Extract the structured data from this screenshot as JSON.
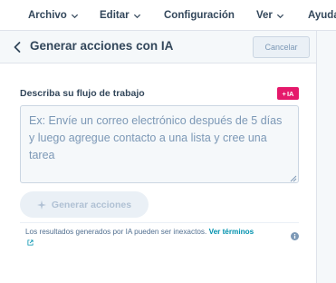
{
  "menubar": {
    "items": [
      {
        "label": "Archivo",
        "has_dropdown": true
      },
      {
        "label": "Editar",
        "has_dropdown": true
      },
      {
        "label": "Configuración",
        "has_dropdown": false
      },
      {
        "label": "Ver",
        "has_dropdown": true
      },
      {
        "label": "Ayuda",
        "has_dropdown": false
      }
    ]
  },
  "panel": {
    "title": "Generar acciones con IA",
    "cancel_label": "Cancelar",
    "field_label": "Describa su flujo de trabajo",
    "ai_badge": "IA",
    "textarea_placeholder": "Ex: Envíe un correo electrónico después de 5 días y luego agregue contacto a una lista y cree una tarea",
    "textarea_value": "",
    "generate_label": "Generar acciones",
    "disclaimer_text": "Los resultados generados por IA pueden ser inexactos.",
    "terms_link": "Ver términos"
  },
  "colors": {
    "accent_pink": "#e5196b",
    "link_teal": "#0091ae",
    "text_primary": "#33475b",
    "header_bg": "#f5f8fa"
  },
  "icons": {
    "back": "chevron-left-icon",
    "dropdown": "chevron-down-icon",
    "sparkle": "sparkle-icon",
    "external": "external-link-icon",
    "info": "info-icon",
    "resize": "resize-grip-icon"
  }
}
